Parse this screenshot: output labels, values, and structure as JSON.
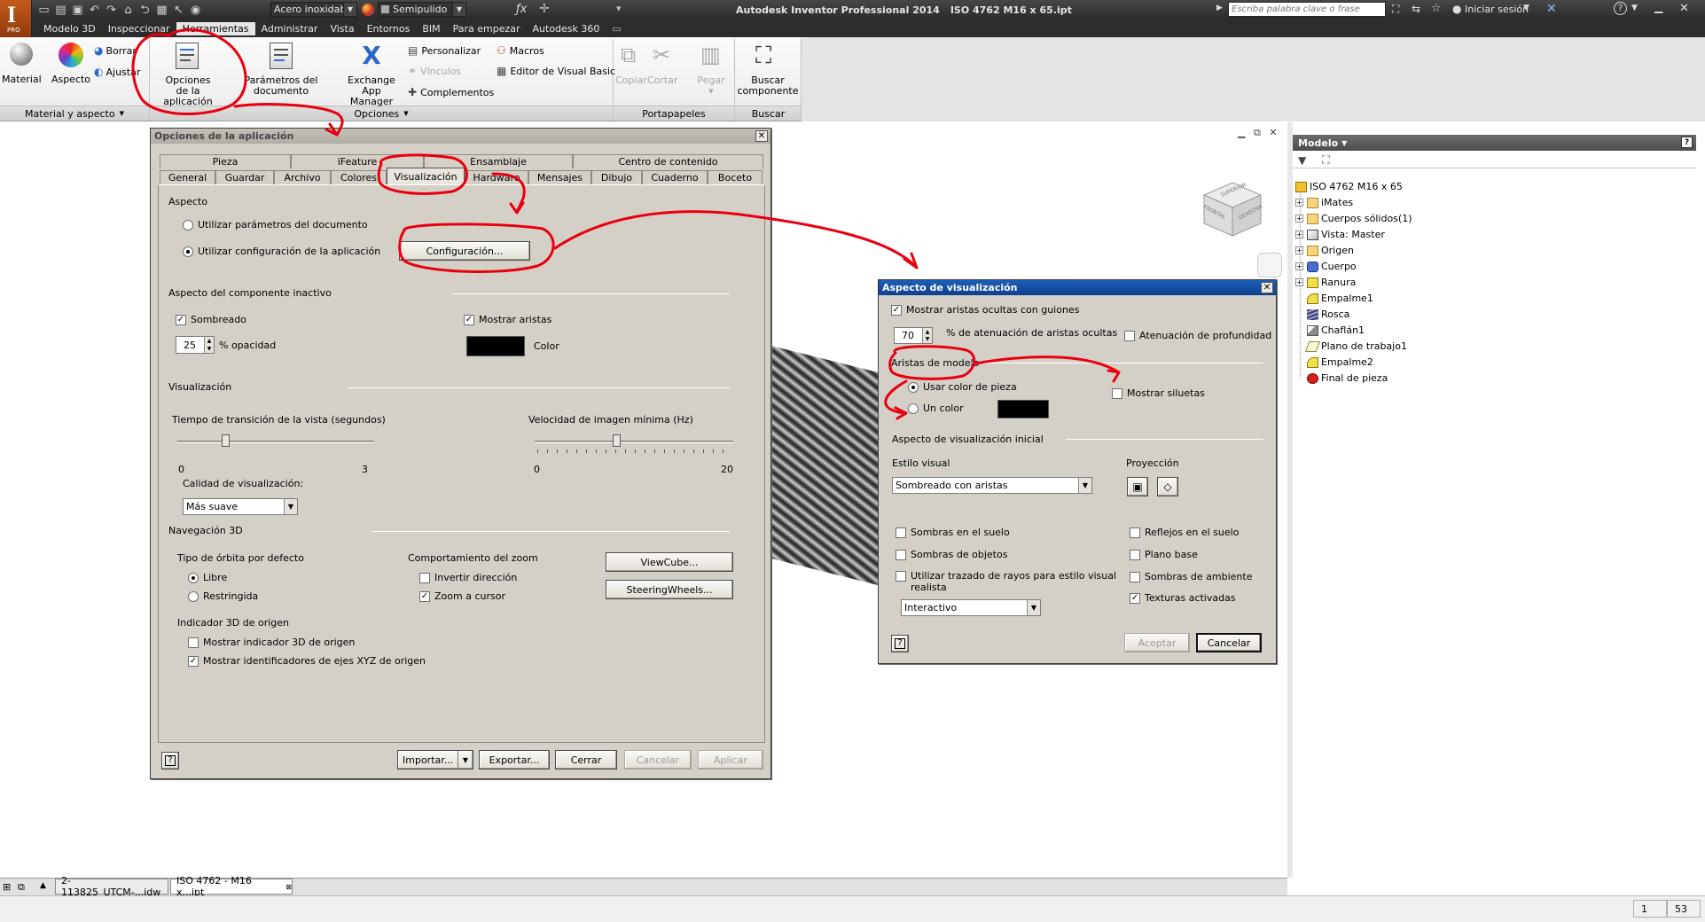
{
  "app": {
    "title": "Autodesk Inventor Professional 2014",
    "document": "ISO 4762 M16 x 65.ipt",
    "search_placeholder": "Escriba palabra clave o frase",
    "signin": "Iniciar sesión",
    "logo_badge": "PRO",
    "material_dropdown": "Acero inoxidabl",
    "finish_dropdown": "Semipulido",
    "fx_label": "ƒx"
  },
  "menu_tabs": [
    {
      "label": "Modelo 3D"
    },
    {
      "label": "Inspeccionar"
    },
    {
      "label": "Herramientas"
    },
    {
      "label": "Administrar"
    },
    {
      "label": "Vista"
    },
    {
      "label": "Entornos"
    },
    {
      "label": "BIM"
    },
    {
      "label": "Para empezar"
    },
    {
      "label": "Autodesk 360"
    }
  ],
  "ribbon": {
    "material": "Material",
    "aspecto": "Aspecto",
    "borrar": "Borrar",
    "ajustar": "Ajustar",
    "opciones_line1": "Opciones",
    "opciones_line2": "de la aplicación",
    "parametros": "Parámetros del documento",
    "exchange_line1": "Exchange",
    "exchange_line2": "App Manager",
    "personalizar": "Personalizar",
    "vinculos": "Vínculos",
    "complementos": "Complementos",
    "macros": "Macros",
    "editor_vb": "Editor de Visual Basic",
    "copiar": "Copiar",
    "cortar": "Cortar",
    "pegar": "Pegar",
    "buscar_line1": "Buscar",
    "buscar_line2": "componente",
    "panels": {
      "material_aspecto": "Material y aspecto",
      "opciones": "Opciones",
      "portapapeles": "Portapapeles",
      "buscar": "Buscar"
    }
  },
  "viewcube": {
    "front": "FRONTAL",
    "side": "DERECHA",
    "top": "SUPERIOR"
  },
  "browser": {
    "title": "Modelo",
    "help": "?",
    "items": [
      {
        "label": "ISO 4762 M16 x 65",
        "icon": "part-icon",
        "expand": false
      },
      {
        "label": "iMates",
        "icon": "folder-icon",
        "expand": true
      },
      {
        "label": "Cuerpos sólidos(1)",
        "icon": "folder-icon",
        "expand": true
      },
      {
        "label": "Vista: Master",
        "icon": "view-icon",
        "expand": true
      },
      {
        "label": "Origen",
        "icon": "folder-icon",
        "expand": true
      },
      {
        "label": "Cuerpo",
        "icon": "revolve-icon",
        "expand": true
      },
      {
        "label": "Ranura",
        "icon": "feature-icon",
        "expand": true
      },
      {
        "label": "Empalme1",
        "icon": "fillet-icon",
        "expand": false
      },
      {
        "label": "Rosca",
        "icon": "thread-icon",
        "expand": false
      },
      {
        "label": "Chaflán1",
        "icon": "chamfer-icon",
        "expand": false
      },
      {
        "label": "Plano de trabajo1",
        "icon": "workplane-icon",
        "expand": false
      },
      {
        "label": "Empalme2",
        "icon": "fillet-icon",
        "expand": false
      },
      {
        "label": "Final de pieza",
        "icon": "end-of-part-icon",
        "expand": false
      }
    ]
  },
  "doc_tabs": [
    {
      "label": "2-113825_UTCM-...idw"
    },
    {
      "label": "ISO 4762 - M16 x...ipt"
    }
  ],
  "status": {
    "a": "1",
    "b": "53"
  },
  "app_options": {
    "title": "Opciones de la aplicación",
    "tabs_row1": [
      "Pieza",
      "iFeature",
      "Ensamblaje",
      "Centro de contenido"
    ],
    "tabs_row2": [
      "General",
      "Guardar",
      "Archivo",
      "Colores",
      "Visualización",
      "Hardware",
      "Mensajes",
      "Dibujo",
      "Cuaderno",
      "Boceto"
    ],
    "aspecto": "Aspecto",
    "usar_doc": "Utilizar parámetros del documento",
    "usar_app": "Utilizar configuración de la aplicación",
    "configuracion": "Configuración...",
    "inactivo": "Aspecto del componente inactivo",
    "sombreado": "Sombreado",
    "opacidad_val": "25",
    "opacidad": "% opacidad",
    "mostrar_aristas": "Mostrar aristas",
    "color": "Color",
    "visualizacion": "Visualización",
    "tiempo": "Tiempo de transición de la vista (segundos)",
    "t_min": "0",
    "t_max": "3",
    "velocidad": "Velocidad de imagen mínima (Hz)",
    "v_min": "0",
    "v_max": "20",
    "calidad": "Calidad de visualización:",
    "calidad_val": "Más suave",
    "navegacion": "Navegación 3D",
    "orbita": "Tipo de órbita por defecto",
    "libre": "Libre",
    "restringida": "Restringida",
    "zoom": "Comportamiento del zoom",
    "invertir": "Invertir dirección",
    "zoom_cursor": "Zoom a cursor",
    "viewcube_btn": "ViewCube...",
    "steering_btn": "SteeringWheels...",
    "indicador": "Indicador 3D de origen",
    "mostrar_indicador": "Mostrar indicador 3D de origen",
    "mostrar_ids": "Mostrar identificadores de ejes XYZ de origen",
    "importar": "Importar...",
    "exportar": "Exportar...",
    "cerrar": "Cerrar",
    "cancelar": "Cancelar",
    "aplicar": "Aplicar"
  },
  "vis_dialog": {
    "title": "Aspecto de visualización",
    "mostrar_ocultas": "Mostrar aristas ocultas con guiones",
    "atenuacion_val": "70",
    "atenuacion": "% de atenuación de aristas ocultas",
    "atenuacion_prof": "Atenuación de profundidad",
    "aristas_modelo": "Aristas de modelo",
    "usar_color": "Usar color de pieza",
    "un_color": "Un color",
    "siluetas": "Mostrar siluetas",
    "inicial": "Aspecto de visualización inicial",
    "estilo": "Estilo visual",
    "estilo_val": "Sombreado con aristas",
    "proyeccion": "Proyección",
    "sombras_suelo": "Sombras en el suelo",
    "reflejos": "Reflejos en el suelo",
    "sombras_objetos": "Sombras de objetos",
    "plano_base": "Plano base",
    "trazado_l1": "Utilizar trazado de rayos para estilo visual",
    "trazado_l2": "realista",
    "sombras_ambiente": "Sombras de ambiente",
    "texturas": "Texturas activadas",
    "interactivo": "Interactivo",
    "aceptar": "Aceptar",
    "cancelar": "Cancelar"
  },
  "colors": {
    "titlebar": "#2b2b2b",
    "ribbon": "#f3f3f3",
    "dialog": "#d4d0c8",
    "annotation": "#e8000f",
    "swatch": "#000000"
  }
}
